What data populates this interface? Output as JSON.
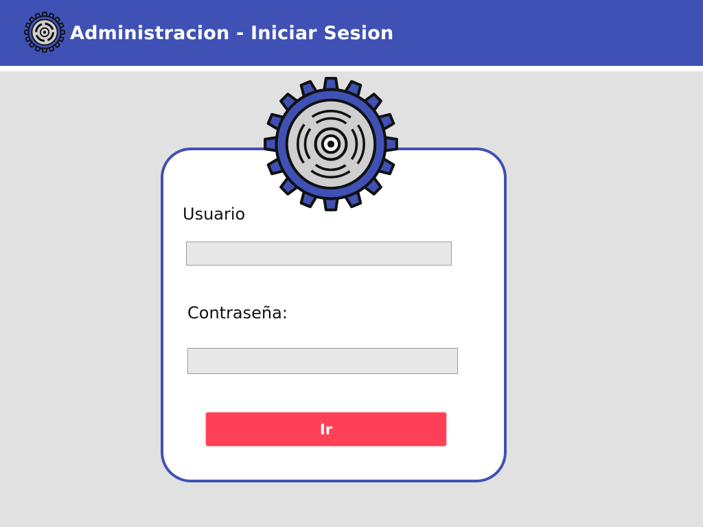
{
  "header": {
    "title": "Administracion - Iniciar Sesion",
    "logo_icon": "gear-icon"
  },
  "login": {
    "icon": "gear-icon",
    "username_label": "Usuario",
    "username_value": "",
    "password_label": "Contraseña:",
    "password_value": "",
    "submit_label": "Ir"
  },
  "colors": {
    "header_bg": "#3f51b5",
    "page_bg": "#e1e1e1",
    "card_border": "#3f51b5",
    "button_bg": "#ff4057",
    "gear_inner": "#cfcfcf"
  }
}
